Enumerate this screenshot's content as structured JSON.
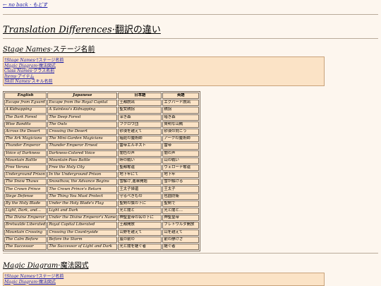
{
  "back_link": "← no back · もどす",
  "page_title": {
    "en": "Translation Differences",
    "jp": "·翻訳の違い"
  },
  "nav_links": [
    {
      "en": "†Stage Names·",
      "jp": "†ステージ名前"
    },
    {
      "en": "Magic Diagram·",
      "jp": "魔法図式"
    },
    {
      "en": "Class Names·",
      "jp": "クラス名前"
    },
    {
      "en": "Items·",
      "jp": "アイテム"
    },
    {
      "en": "Skill Names·",
      "jp": "スキル名前"
    }
  ],
  "section_stage": {
    "en": "Stage Names",
    "jp": "·ステージ名前"
  },
  "table": {
    "headers": [
      "English",
      "Japanese",
      "日本語",
      "英語"
    ],
    "rows": [
      [
        "Escape from Egvard",
        "Escape from the Royal Capital",
        "王都脱出",
        "エグバード脱出"
      ],
      [
        "A Kidnapping",
        "A Saintess's Kidnapping",
        "聖女誘拐",
        "誘拐"
      ],
      [
        "The Dark Forest",
        "The Deep Forest",
        "深き森",
        "暗き森"
      ],
      [
        "Wise Bandits",
        "The Owls",
        "フクロウ団",
        "賢明な山賊"
      ],
      [
        "Across the Desert",
        "Crossing the Desert",
        "砂漠を越えて",
        "砂漠の向こう"
      ],
      [
        "The Ark Magicians",
        "The Mini-Garden Magicians",
        "箱庭の魔術師",
        "アークの魔術師"
      ],
      [
        "Thunder Emperor",
        "Thunder Emperor Ernest",
        "雷帝エルネスト",
        "雷帝"
      ],
      [
        "Voice of Darkness",
        "Darkness-Colored Voice",
        "闇色の声",
        "闇の声"
      ],
      [
        "Mountain Battle",
        "Mountain-Pass Battle",
        "峠の戦い",
        "山の戦い"
      ],
      [
        "Free Verona",
        "Free the Holy City",
        "聖都奪還",
        "ヴェローナ奪還"
      ],
      [
        "Underground Prison",
        "In the Underground Prison",
        "地下牢にて",
        "地下牢"
      ],
      [
        "The Snow Thaws",
        "Snowthaw, the Advance Begins",
        "雪解け,進軍開始",
        "雪が解ける"
      ],
      [
        "The Crown Prince",
        "The Crown Prince's Return",
        "王太子帰還",
        "王太子"
      ],
      [
        "Siege Defense",
        "The Thing You Must Protect",
        "守るべきもの",
        "包囲防衛"
      ],
      [
        "By the Holy Blade",
        "Under the Holy Blade's Flag",
        "聖剣の旗の下に",
        "聖剣で"
      ],
      [
        "Light, Dark, and...",
        "Light and Dark",
        "光と闇と",
        "光と闇と..."
      ],
      [
        "The Divine Emperor",
        "Under the Divine Emperor's Name",
        "神聖皇帝の名の下に",
        "神聖皇帝"
      ],
      [
        "Bretwalde Liberated",
        "Royal Capital Liberated",
        "王都開放",
        "ブレトワルダ開放"
      ],
      [
        "Mountain Crossing",
        "Crossing the Countryside",
        "山野を越えて",
        "山を越えて"
      ],
      [
        "The Calm Before",
        "Before the Storm",
        "嵐の前の",
        "前の静けさ"
      ],
      [
        "The Successor",
        "The Successor of Light and Dark",
        "光と闇を継ぐ者",
        "継ぐ者"
      ]
    ]
  },
  "section_magic": {
    "en": "Magic Diagram",
    "jp": "·魔法図式"
  },
  "nav_links_2": [
    {
      "en": "†Stage Names·",
      "jp": "†ステージ名前"
    },
    {
      "en": "Magic Diagram·",
      "jp": "魔法図式"
    }
  ]
}
